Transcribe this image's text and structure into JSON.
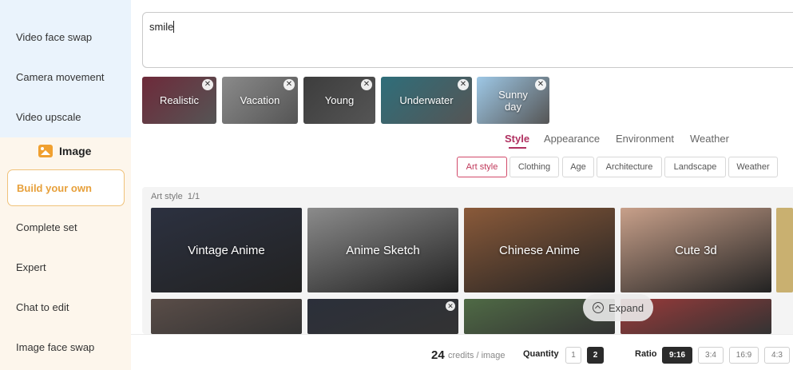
{
  "sidebar": {
    "video_items": [
      "Video face swap",
      "Camera movement",
      "Video upscale"
    ],
    "image_header": "Image",
    "image_items": [
      "Build your own",
      "Complete set",
      "Expert",
      "Chat to edit",
      "Image face swap"
    ]
  },
  "prompt": {
    "value": "smile"
  },
  "chips": [
    {
      "label": "Realistic",
      "color": "#6e2a3a"
    },
    {
      "label": "Vacation",
      "color": "#8a8a8a"
    },
    {
      "label": "Young",
      "color": "#3d3d3d"
    },
    {
      "label": "Underwater",
      "color": "#2f6e7a"
    },
    {
      "label": "Sunny day",
      "color": "#9ec8e6"
    }
  ],
  "tabs": [
    "Style",
    "Appearance",
    "Environment",
    "Weather"
  ],
  "subtabs": [
    "Art style",
    "Clothing",
    "Age",
    "Architecture",
    "Landscape",
    "Weather"
  ],
  "gallery": {
    "label": "Art style  1/1",
    "cards_row1": [
      {
        "label": "Vintage Anime",
        "color": "#2c3140"
      },
      {
        "label": "Anime Sketch",
        "color": "#8b8b8b"
      },
      {
        "label": "Chinese Anime",
        "color": "#8a5a3a"
      },
      {
        "label": "Cute 3d",
        "color": "#c8a08a"
      }
    ],
    "cards_row2_colors": [
      "#5a4d48",
      "#2b2f3a",
      "#4f6a45",
      "#9a3a3a"
    ]
  },
  "expand": {
    "label": "Expand"
  },
  "footer": {
    "credits": "24",
    "credits_unit": "credits / image",
    "quantity_label": "Quantity",
    "quantity_options": [
      "1",
      "2"
    ],
    "quantity_selected": "2",
    "ratio_label": "Ratio",
    "ratio_options": [
      "9:16",
      "3:4",
      "16:9",
      "4:3"
    ],
    "ratio_selected": "9:16"
  },
  "colors": {
    "accent": "#b03060",
    "build_own": "#e7a03b",
    "video_group_bg": "#eaf3fc",
    "image_group_bg": "#fdf6ec"
  }
}
